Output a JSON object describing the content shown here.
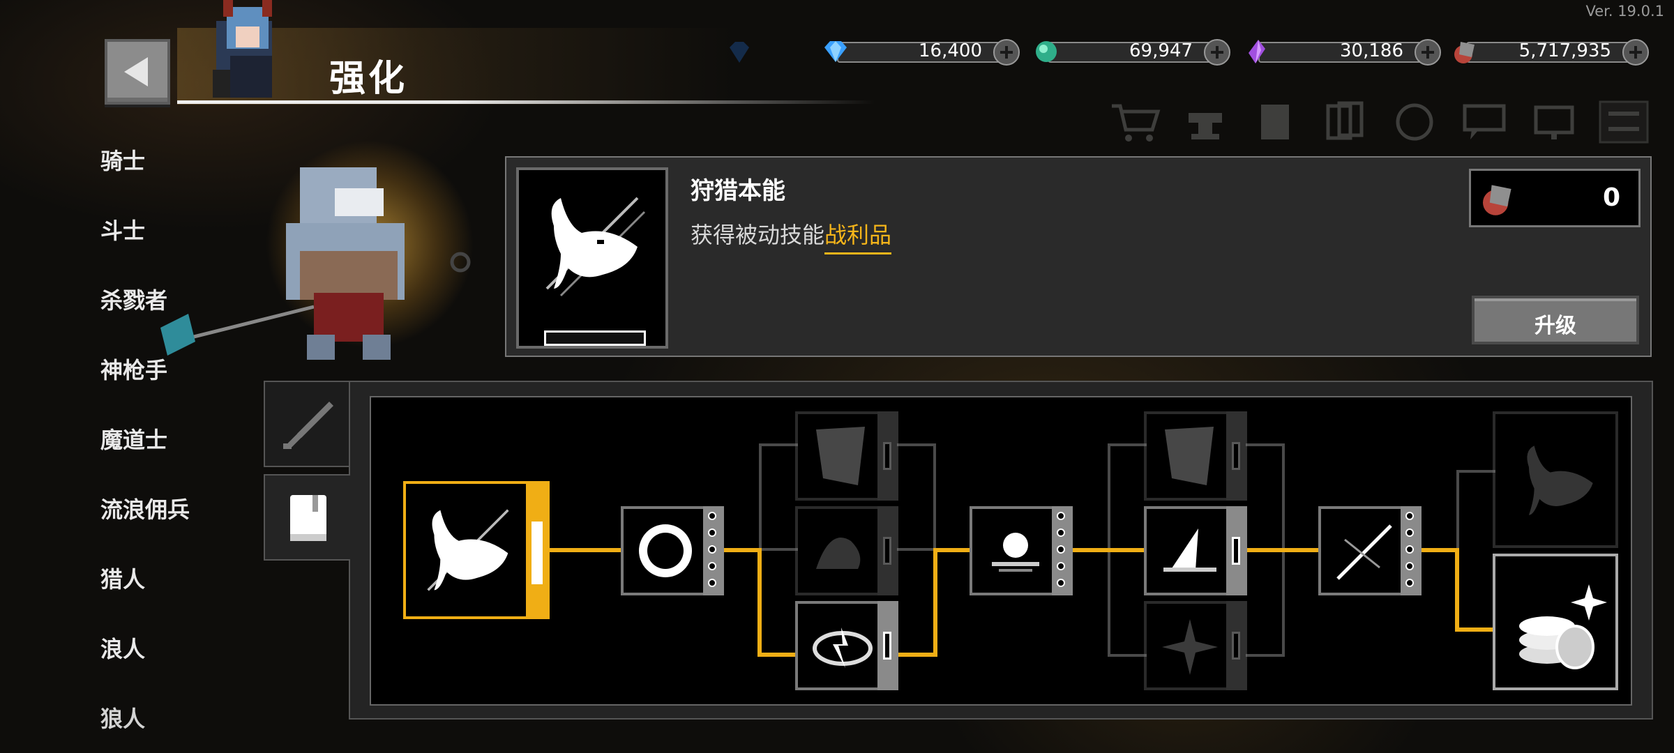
{
  "version": "Ver. 19.0.1",
  "header": {
    "title": "强化",
    "back_icon": "back-arrow-icon"
  },
  "currencies": [
    {
      "name": "gem",
      "icon": "blue-diamond-icon",
      "value": "16,400"
    },
    {
      "name": "emerald",
      "icon": "green-gem-icon",
      "value": "69,947"
    },
    {
      "name": "crystal",
      "icon": "purple-crystal-icon",
      "value": "30,186"
    },
    {
      "name": "ore",
      "icon": "red-ore-icon",
      "value": "5,717,935"
    }
  ],
  "classes": [
    "骑士",
    "斗士",
    "杀戮者",
    "神枪手",
    "魔道士",
    "流浪佣兵",
    "猎人",
    "浪人",
    "狼人"
  ],
  "skill": {
    "name": "狩猎本能",
    "desc_prefix": "获得被动技能",
    "desc_highlight": "战利品",
    "cost": "0",
    "upgrade_label": "升级"
  },
  "colors": {
    "accent": "#f0ae15",
    "highlight_text": "#f5b51a",
    "panel": "#2a2a2a"
  }
}
